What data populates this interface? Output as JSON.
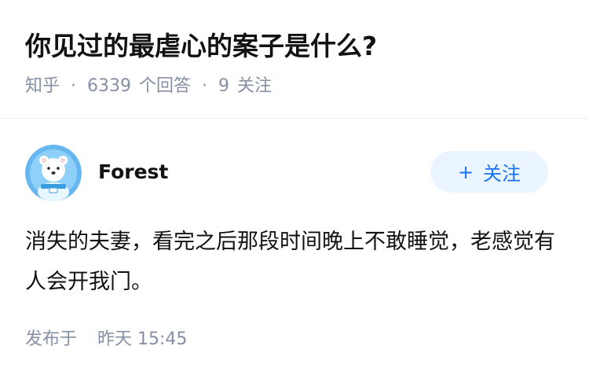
{
  "question": {
    "title": "你见过的最虐心的案子是什么?",
    "source": "知乎",
    "answers_count": "6339",
    "answers_label": "个回答",
    "followers_count": "9",
    "followers_label": "关注"
  },
  "answer": {
    "author": {
      "name": "Forest",
      "avatar_icon": "avatar-bear-icon"
    },
    "follow_button": {
      "icon": "plus-icon",
      "label": "关注"
    },
    "text": "消失的夫妻，看完之后那段时间晚上不敢睡觉，老感觉有人会开我门。",
    "published_label": "发布于",
    "published_time": "昨天 15:45"
  },
  "colors": {
    "title": "#121212",
    "meta": "#8590a6",
    "accent": "#1772f6",
    "follow_bg": "#ebf5ff",
    "avatar_bg": "#66b6f0"
  }
}
